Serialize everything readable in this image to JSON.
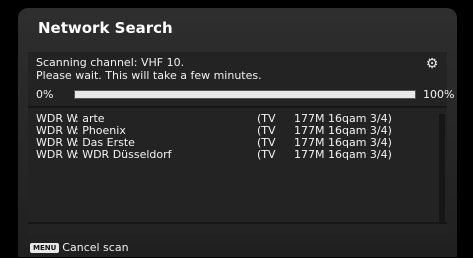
{
  "title": "Network Search",
  "status": {
    "line1": "Scanning channel: VHF 10.",
    "line2": "Please wait. This will take a few minutes."
  },
  "progress": {
    "start_label": "0%",
    "end_label": "100%",
    "value_percent": 100
  },
  "channels": [
    {
      "name": "WDR W",
      "program": ": arte",
      "type": "(TV",
      "info": "177M 16qam 3/4)"
    },
    {
      "name": "WDR W",
      "program": ": Phoenix",
      "type": "(TV",
      "info": "177M 16qam 3/4)"
    },
    {
      "name": "WDR W",
      "program": ": Das Erste",
      "type": "(TV",
      "info": "177M 16qam 3/4)"
    },
    {
      "name": "WDR W",
      "program": ": WDR Düsseldorf",
      "type": "(TV",
      "info": "177M 16qam 3/4)"
    }
  ],
  "footer": {
    "key_label": "MENU",
    "action_label": "Cancel scan"
  },
  "icons": {
    "settings": "gear-icon"
  }
}
